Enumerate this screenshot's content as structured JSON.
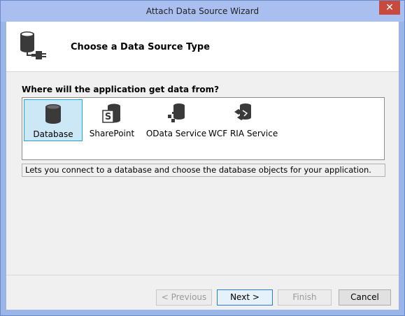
{
  "window": {
    "title": "Attach Data Source Wizard",
    "close_glyph": "✕"
  },
  "header": {
    "title": "Choose a Data Source Type",
    "icon": "database-connector-icon"
  },
  "question": "Where will the application get data from?",
  "sources": [
    {
      "label": "Database",
      "icon": "database-icon",
      "selected": true
    },
    {
      "label": "SharePoint",
      "icon": "sharepoint-icon",
      "selected": false
    },
    {
      "label": "OData Service",
      "icon": "odata-service-icon",
      "selected": false
    },
    {
      "label": "WCF RIA Service",
      "icon": "wcf-ria-service-icon",
      "selected": false
    }
  ],
  "description": "Lets you connect to a database and choose the database objects for your application.",
  "buttons": {
    "previous": "< Previous",
    "next": "Next >",
    "finish": "Finish",
    "cancel": "Cancel"
  },
  "colors": {
    "selection_bg": "#cce8f7",
    "selection_border": "#26a0da",
    "titlebar": "#a8bff0",
    "close": "#c74a3f"
  }
}
